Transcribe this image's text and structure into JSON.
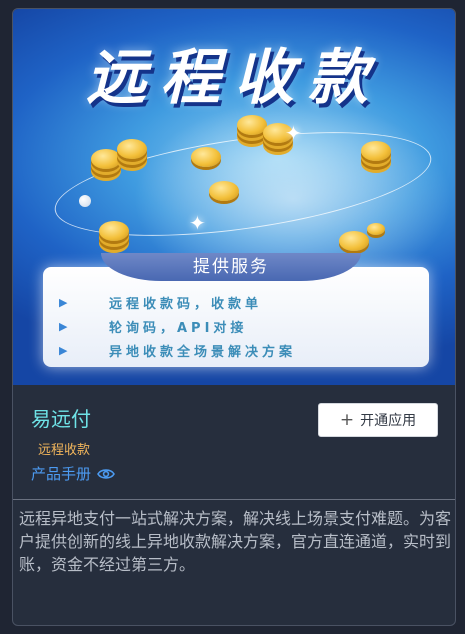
{
  "banner": {
    "title": "远程收款",
    "service_heading": "提供服务",
    "services": [
      "远程收款码，收款单",
      "轮询码，API对接",
      "异地收款全场景解决方案"
    ]
  },
  "app": {
    "name": "易远付",
    "tag": "远程收款",
    "manual_label": "产品手册",
    "open_button_label": "开通应用",
    "description": "远程异地支付一站式解决方案，解决线上场景支付难题。为客户提供创新的线上异地收款解决方案，官方直连通道，实时到账，资金不经过第三方。"
  },
  "colors": {
    "app_name": "#6fe3e7",
    "tag": "#f2b65c",
    "link": "#4c9bf2",
    "card_bg": "#262e3d"
  },
  "icons": {
    "manual": "eye-icon",
    "open": "plus-icon"
  }
}
